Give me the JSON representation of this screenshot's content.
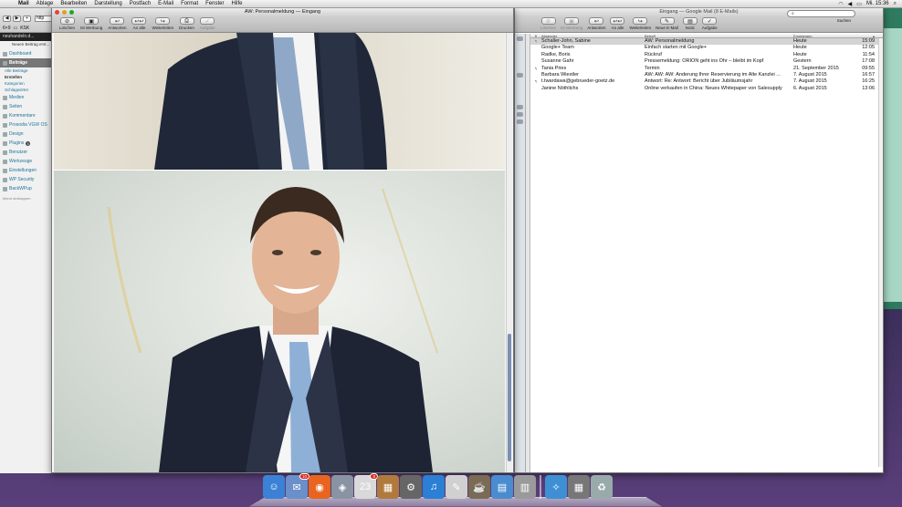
{
  "menubar": {
    "apple": "",
    "items": [
      "Mail",
      "Ablage",
      "Bearbeiten",
      "Darstellung",
      "Postfach",
      "E-Mail",
      "Format",
      "Fenster",
      "Hilfe"
    ],
    "clock": "Mi. 15:36"
  },
  "browser": {
    "url": "http",
    "bookmarks": [
      "6×9",
      "KSK"
    ],
    "admin_bar": "neuhandeln.d...",
    "notice": "Neuen Beitrag erst...",
    "menu": [
      {
        "label": "Dashboard"
      },
      {
        "label": "Beiträge",
        "active": true
      },
      {
        "label": "Medien"
      },
      {
        "label": "Seiten"
      },
      {
        "label": "Kommentare"
      },
      {
        "label": "Prosodia VGW OS"
      },
      {
        "label": "Design"
      },
      {
        "label": "Plugins",
        "badge": "3"
      },
      {
        "label": "Benutzer"
      },
      {
        "label": "Werkzeuge"
      },
      {
        "label": "Einstellungen"
      },
      {
        "label": "WP Security"
      },
      {
        "label": "BackWPup"
      }
    ],
    "submenu": [
      "Alle Beiträge",
      "Erstellen",
      "Kategorien",
      "Schlagwörter"
    ],
    "collapse": "Menü einklappen"
  },
  "message_window": {
    "title": "AW: Personalmeldung — Eingang",
    "toolbar": [
      {
        "label": "Löschen",
        "icon": "trash-icon",
        "glyph": "⊘"
      },
      {
        "label": "Ist Werbung",
        "icon": "junk-icon",
        "glyph": "▣"
      },
      {
        "label": "Antworten",
        "icon": "reply-icon",
        "glyph": "↩"
      },
      {
        "label": "An alle",
        "icon": "reply-all-icon",
        "glyph": "↩↩"
      },
      {
        "label": "Weiterleiten",
        "icon": "forward-icon",
        "glyph": "↪"
      },
      {
        "label": "Drucken",
        "icon": "print-icon",
        "glyph": "⎙"
      },
      {
        "label": "Aufgabe",
        "icon": "task-icon",
        "glyph": "✓",
        "dim": true
      }
    ]
  },
  "mail_window": {
    "title": "Eingang — Google Mail (8 E-Mails)",
    "toolbar": [
      {
        "label": "Löschen",
        "icon": "trash-icon",
        "glyph": "⊘",
        "dim": true
      },
      {
        "label": "Ist Werbung",
        "icon": "junk-icon",
        "glyph": "▣",
        "dim": true
      },
      {
        "label": "Antworten",
        "icon": "reply-icon",
        "glyph": "↩"
      },
      {
        "label": "An alle",
        "icon": "reply-all-icon",
        "glyph": "↩↩"
      },
      {
        "label": "Weiterleiten",
        "icon": "forward-icon",
        "glyph": "↪"
      },
      {
        "label": "Neue E-Mail",
        "icon": "compose-icon",
        "glyph": "✎"
      },
      {
        "label": "Notiz",
        "icon": "note-icon",
        "glyph": "▤"
      },
      {
        "label": "Aufgabe",
        "icon": "task-icon",
        "glyph": "✓"
      }
    ],
    "search_placeholder": "",
    "search_label": "Suchen",
    "columns": {
      "from": "Absender",
      "subject": "Betreff",
      "date": "Empfangen"
    },
    "messages": [
      {
        "flag": "↰",
        "from": "Schaller-John, Sabine",
        "subject": "AW: Personalmeldung",
        "date": "Heute",
        "time": "15:09",
        "selected": true
      },
      {
        "flag": "",
        "from": "Google+ Team",
        "subject": "Einfach starten mit Google+",
        "date": "Heute",
        "time": "12:05"
      },
      {
        "flag": "",
        "from": "Radke, Boris",
        "subject": "Rückruf",
        "date": "Heute",
        "time": "11:54"
      },
      {
        "flag": "",
        "from": "Susanne Gahr",
        "subject": "Pressemeldung: ORION geht ins Ohr – bleibt im Kopf",
        "date": "Gestern",
        "time": "17:08"
      },
      {
        "flag": "↰",
        "from": "Tania Pries",
        "subject": "Termin",
        "date": "21. September 2015",
        "time": "09:55"
      },
      {
        "flag": "",
        "from": "Barbara Wiestler",
        "subject": "AW: AW: AW: Änderung Ihrer Reservierung im Alte Kanzlei ...",
        "date": "7. August 2015",
        "time": "16:57"
      },
      {
        "flag": "↰",
        "from": "t.twardawa@gebrueder-goetz.de",
        "subject": "Antwort: Re: Antwort: Bericht über Jubiläumsjahr",
        "date": "7. August 2015",
        "time": "16:25"
      },
      {
        "flag": "",
        "from": "Janine Nöthlichs",
        "subject": "Online verkaufen in China: Neues Whitepaper von Salesupply",
        "date": "6. August 2015",
        "time": "13:06"
      }
    ]
  },
  "dock": {
    "apps": [
      {
        "name": "finder-icon",
        "glyph": "☺",
        "color": "#3b82d6"
      },
      {
        "name": "mail-stamp-icon",
        "glyph": "✉",
        "color": "#6b8fc9",
        "badge": "10"
      },
      {
        "name": "firefox-icon",
        "glyph": "◉",
        "color": "#e8641f"
      },
      {
        "name": "preview-icon",
        "glyph": "◈",
        "color": "#8a93a3"
      },
      {
        "name": "calendar-icon",
        "glyph": "23",
        "color": "#d9d9d9",
        "badge": "8"
      },
      {
        "name": "photo-icon",
        "glyph": "▦",
        "color": "#b07a3c"
      },
      {
        "name": "settings-icon",
        "glyph": "⚙",
        "color": "#666"
      },
      {
        "name": "itunes-icon",
        "glyph": "♫",
        "color": "#2b7fd5"
      },
      {
        "name": "textedit-icon",
        "glyph": "✎",
        "color": "#d0d0d0"
      },
      {
        "name": "coffee-icon",
        "glyph": "☕",
        "color": "#7a6b55"
      },
      {
        "name": "document-icon",
        "glyph": "▤",
        "color": "#4a8ccf"
      },
      {
        "name": "stacks-icon",
        "glyph": "▥",
        "color": "#9a9a9a"
      },
      {
        "name": "safari-icon",
        "glyph": "✧",
        "color": "#3f8fd4"
      },
      {
        "name": "apps-folder-icon",
        "glyph": "▦",
        "color": "#777"
      },
      {
        "name": "trash-icon",
        "glyph": "♻",
        "color": "#9aa"
      }
    ]
  }
}
